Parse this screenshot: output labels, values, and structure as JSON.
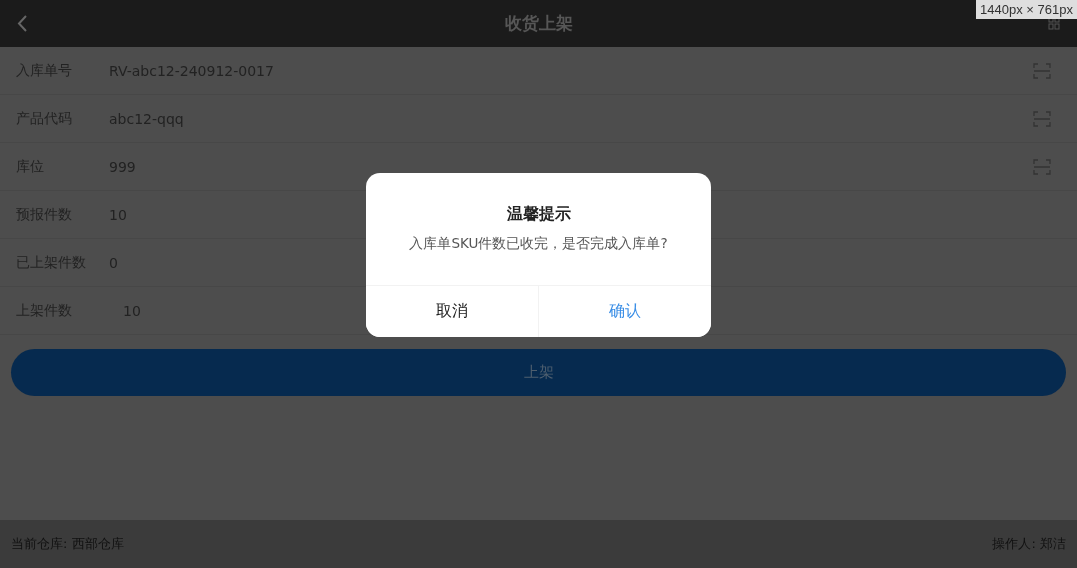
{
  "header": {
    "title": "收货上架"
  },
  "size_tooltip": "1440px × 761px",
  "fields": [
    {
      "label": "入库单号",
      "value": "RV-abc12-240912-0017",
      "kind": "display",
      "scannable": true
    },
    {
      "label": "产品代码",
      "value": "abc12-qqq",
      "kind": "display",
      "scannable": true
    },
    {
      "label": "库位",
      "value": "999",
      "kind": "display",
      "scannable": true
    },
    {
      "label": "预报件数",
      "value": "10",
      "kind": "display",
      "scannable": false
    },
    {
      "label": "已上架件数",
      "value": "0",
      "kind": "display",
      "scannable": false
    },
    {
      "label": "上架件数",
      "value": "10",
      "kind": "input",
      "scannable": false
    }
  ],
  "submit_button": "上架",
  "status_bar": {
    "warehouse": "当前仓库: 西部仓库",
    "operator": "操作人: 郑洁"
  },
  "dialog": {
    "title": "温馨提示",
    "message": "入库单SKU件数已收完，是否完成入库单?",
    "buttons": [
      {
        "label": "取消",
        "kind": "cancel"
      },
      {
        "label": "确认",
        "kind": "confirm"
      }
    ]
  }
}
